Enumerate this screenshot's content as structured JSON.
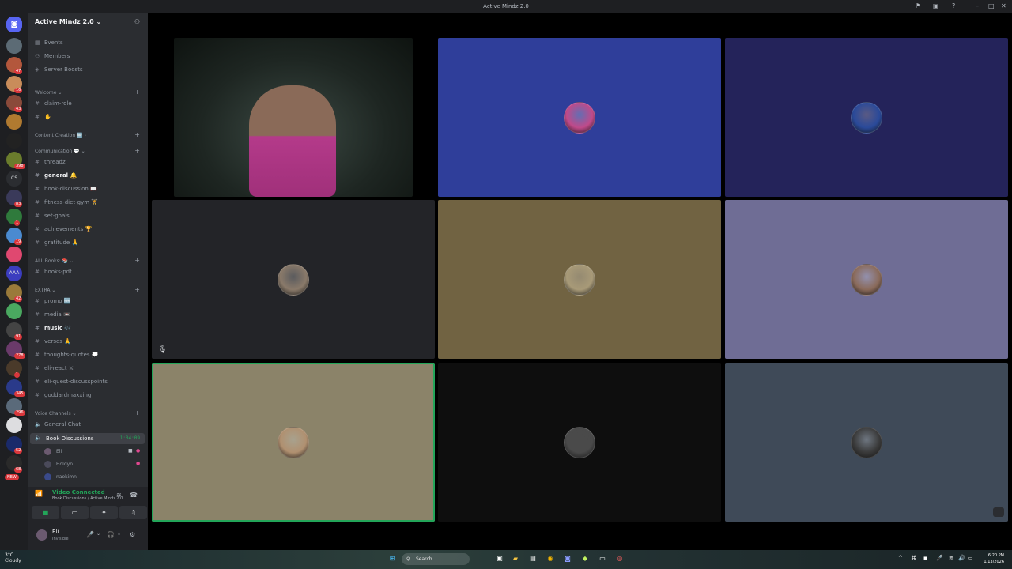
{
  "window": {
    "title": "Active Mindz 2.0"
  },
  "server_rail": {
    "icons": [
      {
        "color": "#5c6b75"
      },
      {
        "color": "#b3573c",
        "badge": "47"
      },
      {
        "color": "#c98c5a",
        "badge": "16"
      },
      {
        "color": "#8a4a3a",
        "badge": "43"
      },
      {
        "color": "#b07a30"
      },
      {
        "color": "#222222"
      },
      {
        "color": "#6a7c2c",
        "badge": "398"
      },
      {
        "color": "#2b2d31",
        "text": "CS"
      },
      {
        "color": "#3a3a5a",
        "badge": "83"
      },
      {
        "color": "#2f7a3c",
        "badge": "1"
      },
      {
        "color": "#4a8ad0",
        "badge": "19"
      },
      {
        "color": "#e04870"
      },
      {
        "color": "#3b3dbf",
        "text": "AAA"
      },
      {
        "color": "#9a7a3a",
        "badge": "42"
      },
      {
        "color": "#4aa860"
      },
      {
        "color": "#444444",
        "badge": "91"
      },
      {
        "color": "#6a3a6a",
        "badge": "278"
      },
      {
        "color": "#4a3a2a",
        "badge": "1"
      },
      {
        "color": "#2a3a8a",
        "badge": "345"
      },
      {
        "color": "#5a6a7a",
        "badge": "296"
      },
      {
        "color": "#dddde0"
      },
      {
        "color": "#1a2a6a",
        "badge": "52"
      },
      {
        "color": "#2a2a2a",
        "badge": "68"
      }
    ],
    "new_label": "NEW"
  },
  "channels": {
    "server_name": "Active Mindz 2.0",
    "top_items": [
      "Events",
      "Members",
      "Server Boosts"
    ],
    "categories": {
      "welcome": "Welcome",
      "content": "Content Creation",
      "communication": "Communication",
      "books": "ALL Books:",
      "extra": "EXTRA",
      "voice": "Voice Channels"
    },
    "welcome_channels": [
      "claim-role",
      "✋"
    ],
    "communication_channels": [
      "threadz",
      "general",
      "book-discussion",
      "fitness-diet-gym",
      "set-goals",
      "achievements",
      "gratitude"
    ],
    "communication_emojis": [
      "",
      "🔔",
      "📖",
      "🏋",
      "",
      "🏆",
      "🙏"
    ],
    "book_channels": [
      "books-pdf"
    ],
    "extra_channels": [
      "promo",
      "media",
      "music",
      "verses",
      "thoughts-quotes",
      "eli-react",
      "eli-quest-discusspoints",
      "goddardmaxxing"
    ],
    "extra_emojis": [
      "🆕",
      "📼",
      "🎶",
      "🙏",
      "💭",
      "⚔",
      "",
      ""
    ],
    "voice_channels": [
      "General Chat",
      "Book Discussions"
    ],
    "voice_timer": "1:04:09",
    "voice_users": [
      "Eli",
      "Holdyn",
      "naokimn"
    ]
  },
  "user_panel": {
    "status_title": "Video Connected",
    "status_sub": "Book Discussions / Active Mindz 2.0",
    "name": "Eli",
    "presence": "Invisible"
  },
  "tiles": [
    {
      "bg": "#1a1c1a",
      "avatar": "#6a5a48",
      "video": true
    },
    {
      "bg": "#2f3e9a",
      "avatar": "#c04a8a"
    },
    {
      "bg": "#24235a",
      "avatar": "#2a4a9a"
    },
    {
      "bg": "#232428",
      "avatar": "#8a7a6a",
      "muted": true
    },
    {
      "bg": "#716342",
      "avatar": "#a89a78"
    },
    {
      "bg": "#6f6d95",
      "avatar": "#8a6a5a"
    },
    {
      "bg": "#8b8369",
      "avatar": "#b09070",
      "speaking": true
    },
    {
      "bg": "#0e0e0e",
      "avatar": "#4a4a4a"
    },
    {
      "bg": "#3f4a58",
      "avatar": "#3a3a3a"
    }
  ],
  "taskbar": {
    "weather_temp": "3°C",
    "weather_desc": "Cloudy",
    "search_label": "Search",
    "time": "6:20 PM",
    "date": "1/13/2026"
  }
}
